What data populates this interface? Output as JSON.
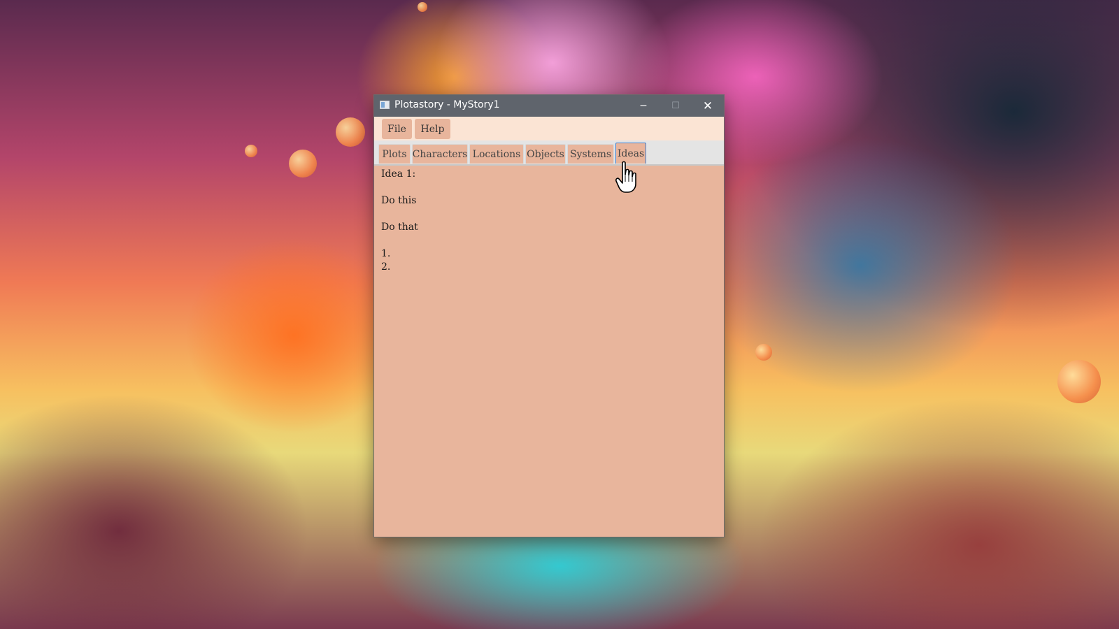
{
  "window": {
    "title": "Plotastory - MyStory1",
    "controls": {
      "minimize": "─",
      "maximize": "☐",
      "close": "✕"
    }
  },
  "menu": {
    "items": [
      {
        "label": "File"
      },
      {
        "label": "Help"
      }
    ]
  },
  "tabs": {
    "items": [
      {
        "label": "Plots",
        "active": false
      },
      {
        "label": "Characters",
        "active": false
      },
      {
        "label": "Locations",
        "active": false
      },
      {
        "label": "Objects",
        "active": false
      },
      {
        "label": "Systems",
        "active": false
      },
      {
        "label": "Ideas",
        "active": true
      }
    ]
  },
  "editor": {
    "lines": [
      "Idea 1:",
      "",
      "Do this",
      "",
      "Do that",
      "",
      "1.",
      "2."
    ]
  },
  "colors": {
    "accent_tab_border": "#3d7fd0",
    "title_bar": "#5f646c",
    "content_background": "#e8b59c",
    "menu_background": "#fbe4d4"
  },
  "icons": {
    "app": "app-window-icon",
    "cursor": "hand-pointer-icon"
  }
}
